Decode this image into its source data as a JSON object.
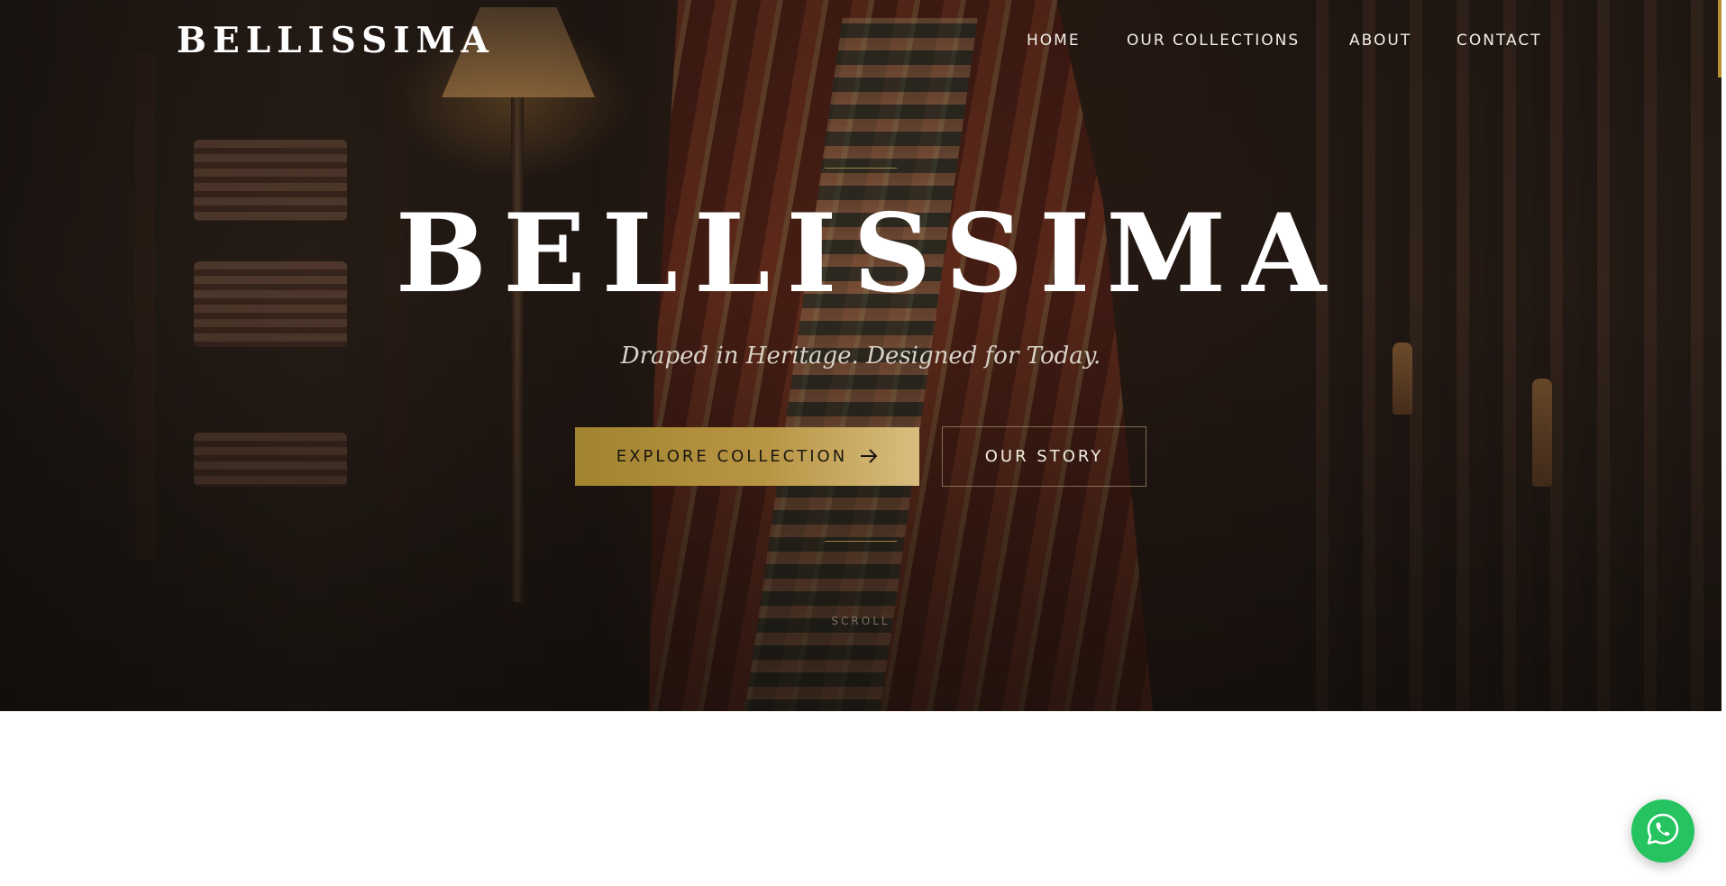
{
  "brand": {
    "logo_text": "BELLISSIMA"
  },
  "nav": {
    "items": [
      {
        "label": "HOME"
      },
      {
        "label": "OUR COLLECTIONS"
      },
      {
        "label": "ABOUT"
      },
      {
        "label": "CONTACT"
      }
    ]
  },
  "hero": {
    "title": "BELLISSIMA",
    "tagline": "Draped in Heritage. Designed for Today.",
    "primary_button": {
      "label": "EXPLORE COLLECTION",
      "icon": "arrow-right-icon"
    },
    "secondary_button": {
      "label": "OUR STORY"
    },
    "scroll_label": "SCROLL"
  },
  "floating": {
    "whatsapp_icon": "whatsapp-icon"
  },
  "colors": {
    "accent_gold": "#b89544",
    "whatsapp_green": "#25c461",
    "hero_dark": "#1d1612"
  }
}
